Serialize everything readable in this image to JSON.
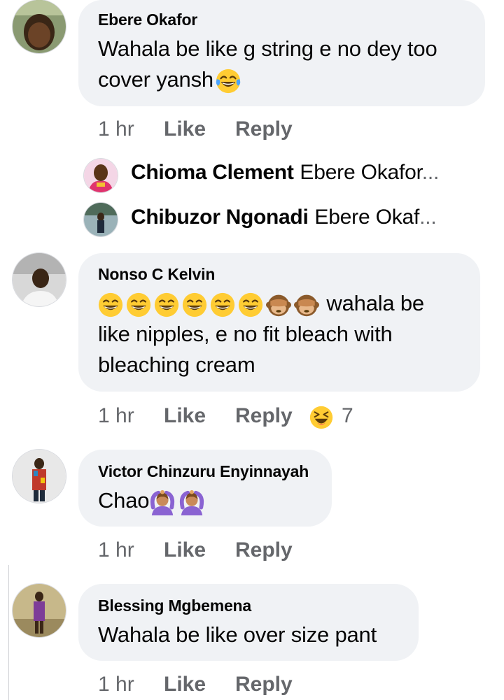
{
  "comments": [
    {
      "author": "Ebere Okafor",
      "text_line1": "Wahala be like g string e no dey too",
      "text_line2": "cover yansh",
      "trailing_emoji": "tears-of-joy",
      "time": "1 hr",
      "like_label": "Like",
      "reply_label": "Reply",
      "replies": [
        {
          "name": "Chioma Clement",
          "preview": "Ebere Okafor",
          "ellipsis": "..."
        },
        {
          "name": "Chibuzor Ngonadi",
          "preview": "Ebere Okaf",
          "ellipsis": "..."
        }
      ]
    },
    {
      "author": "Nonso C Kelvin",
      "emojis": [
        "grinning-squint",
        "grinning-squint",
        "grinning-squint",
        "grinning-squint",
        "grinning-squint",
        "grinning-squint",
        "see-no-evil-monkey",
        "see-no-evil-monkey"
      ],
      "text_line1": "wahala be",
      "text_line2": "like nipples, e no fit bleach with",
      "text_line3": "bleaching cream",
      "time": "1 hr",
      "like_label": "Like",
      "reply_label": "Reply",
      "reaction_emoji": "laughing-face",
      "reaction_count": "7"
    },
    {
      "author": "Victor Chinzuru Enyinnayah",
      "text": "Chao",
      "emojis": [
        "person-gesturing-ok",
        "person-gesturing-ok"
      ],
      "time": "1 hr",
      "like_label": "Like",
      "reply_label": "Reply"
    },
    {
      "author": "Blessing Mgbemena",
      "text": "Wahala be like over size pant",
      "time": "1 hr",
      "like_label": "Like",
      "reply_label": "Reply"
    }
  ],
  "colors": {
    "bubble": "#f0f2f5",
    "meta_text": "#65676b",
    "primary_text": "#050505",
    "emoji_yellow": "#ffcc33"
  }
}
